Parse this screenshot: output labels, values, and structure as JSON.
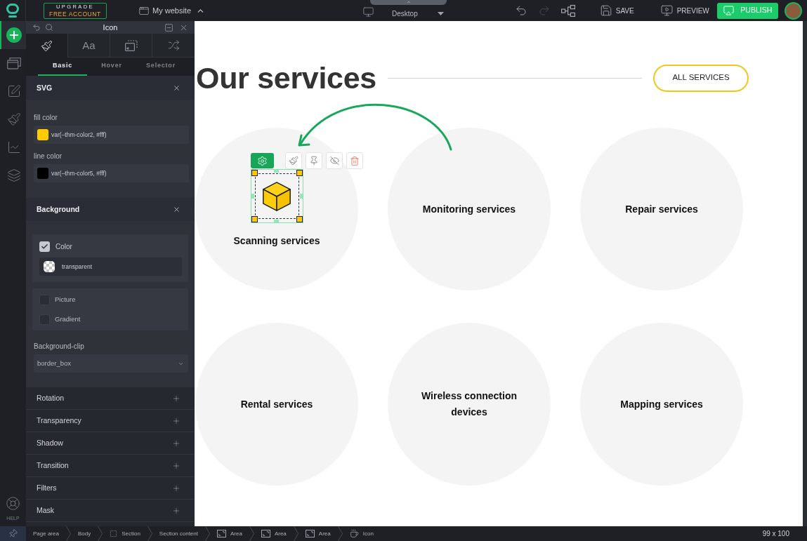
{
  "top_bar": {
    "upgrade": {
      "title": "UPGRADE",
      "subtitle": "FREE ACCOUNT"
    },
    "site": {
      "label": "My website",
      "expanded": true
    },
    "device": {
      "label": "Desktop"
    },
    "history": [
      {
        "kind": "undo",
        "disabled": false
      },
      {
        "kind": "redo",
        "disabled": true
      }
    ],
    "save": {
      "label": "SAVE"
    },
    "preview": {
      "label": "PREVIEW"
    },
    "publish": {
      "label": "PUBLISH"
    }
  },
  "sidebar": {
    "items": [
      {
        "kind": "add",
        "selected": true
      },
      {
        "kind": "pages",
        "selected": false
      },
      {
        "kind": "edit",
        "selected": false
      },
      {
        "kind": "design",
        "selected": false
      },
      {
        "kind": "analytics",
        "selected": false
      },
      {
        "kind": "layers",
        "selected": false
      }
    ],
    "help": {
      "label": "HELP"
    }
  },
  "panel": {
    "title": "Icon",
    "tabs": [
      {
        "kind": "style",
        "selected": true
      },
      {
        "kind": "typography",
        "label": "Aa",
        "selected": false
      },
      {
        "kind": "layout",
        "selected": false
      },
      {
        "kind": "shuffle",
        "selected": false
      }
    ],
    "subtabs": [
      {
        "label": "Basic",
        "selected": true
      },
      {
        "label": "Hover",
        "selected": false
      },
      {
        "label": "Selector",
        "selected": false
      }
    ],
    "svg": {
      "title": "SVG",
      "fields": [
        {
          "label": "fill color",
          "color": "#ffcc00",
          "value": "var(–thm-color2, #fff)"
        },
        {
          "label": "line color",
          "color": "#000000",
          "value": "var(–thm-color5, #fff)"
        }
      ]
    },
    "background": {
      "title": "Background",
      "color_option": {
        "label": "Color",
        "checked": true,
        "value": "transparent"
      },
      "options": [
        {
          "label": "Picture",
          "checked": false
        },
        {
          "label": "Gradient",
          "checked": false
        }
      ],
      "clip": {
        "label": "Background-clip",
        "value": "border_box"
      }
    },
    "more_sections": [
      {
        "title": "Rotation",
        "expanded": false
      },
      {
        "title": "Transparency",
        "expanded": false
      },
      {
        "title": "Shadow",
        "expanded": false
      },
      {
        "title": "Transition",
        "expanded": false
      },
      {
        "title": "Filters",
        "expanded": false
      },
      {
        "title": "Mask",
        "expanded": false
      }
    ]
  },
  "canvas": {
    "heading": "Our services",
    "button": {
      "label": "ALL SERVICES"
    },
    "services": [
      {
        "name": "Scanning services",
        "icon": {
          "selected": true
        }
      },
      {
        "name": "Monitoring services"
      },
      {
        "name": "Repair services"
      },
      {
        "name": "Rental services"
      },
      {
        "name": "Wireless connection devices"
      },
      {
        "name": "Mapping services"
      }
    ]
  },
  "breadcrumb": [
    {
      "label": "Page area",
      "kind": "plain"
    },
    {
      "label": "Body",
      "kind": "plain"
    },
    {
      "label": "Section",
      "kind": "section"
    },
    {
      "label": "Section content",
      "kind": "plain"
    },
    {
      "label": "Area",
      "kind": "area"
    },
    {
      "label": "Area",
      "kind": "area"
    },
    {
      "label": "Area",
      "kind": "area"
    },
    {
      "label": "Icon",
      "kind": "icon"
    }
  ],
  "status_bar": {
    "size": "99 x 100"
  }
}
